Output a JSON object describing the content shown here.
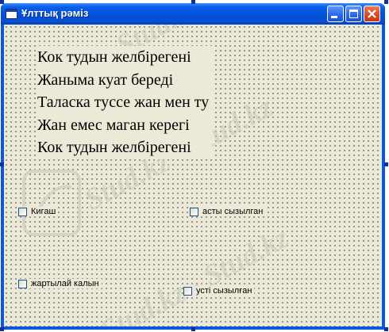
{
  "window": {
    "title": "Ұлттық рәміз"
  },
  "poem": {
    "lines": [
      "Кок тудын желбiрегенi",
      "Жаныма куат бередi",
      "Таласка туссе жан мен ту",
      "Жан емес маган керегi",
      "Кок тудын желбiрегенi"
    ]
  },
  "checkboxes": {
    "italic": {
      "label": "Кигаш",
      "checked": false
    },
    "underline": {
      "label": "асты сызылган",
      "checked": false
    },
    "half_bold": {
      "label": "жартылай калын",
      "checked": false
    },
    "overline": {
      "label": "усті сызылған",
      "checked": false
    }
  },
  "watermark": {
    "text": "Stud.kz - Stud.kz"
  },
  "colors": {
    "titlebar": "#0a58e0",
    "client": "#ece9d8",
    "close_button": "#d64a22"
  }
}
